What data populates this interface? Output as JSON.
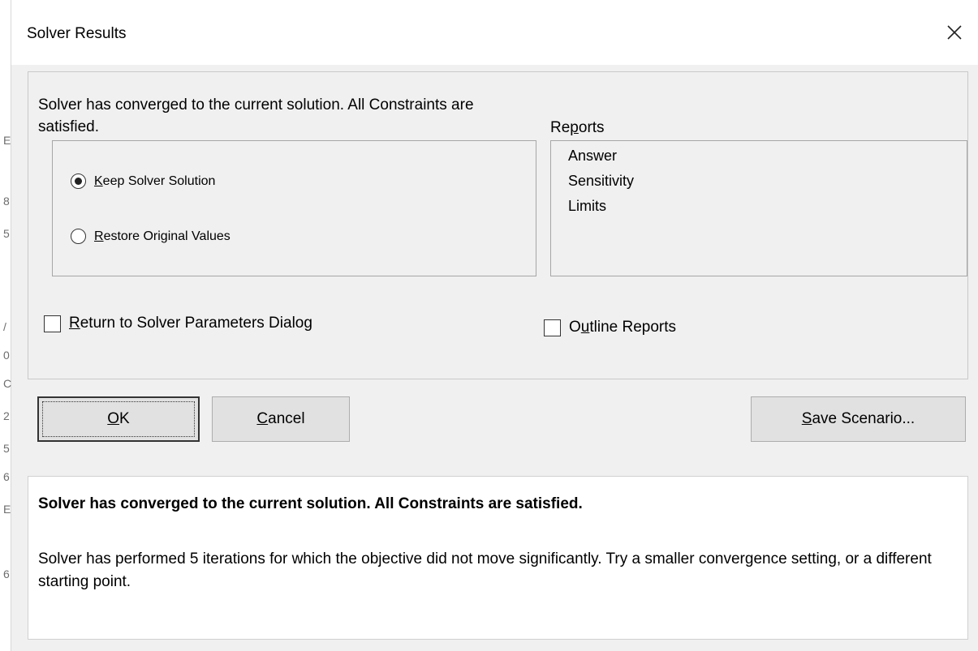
{
  "edge_glyphs": [
    "E",
    "8",
    "5",
    "/",
    "0",
    "C",
    "2",
    "5",
    "6",
    "E",
    "6"
  ],
  "window": {
    "title": "Solver Results",
    "close_icon": "close-x-icon"
  },
  "status_message": "Solver has converged to the current solution.  All Constraints are satisfied.",
  "options": {
    "keep": {
      "pre": "",
      "key": "K",
      "post": "eep Solver Solution",
      "selected": true
    },
    "restore": {
      "pre": "",
      "key": "R",
      "post": "estore Original Values",
      "selected": false
    }
  },
  "reports": {
    "label": {
      "pre": "Re",
      "key": "p",
      "post": "orts"
    },
    "items": [
      "Answer",
      "Sensitivity",
      "Limits"
    ]
  },
  "checkboxes": {
    "return_dialog": {
      "pre": "",
      "key": "R",
      "post": "eturn to Solver Parameters Dialog",
      "checked": false
    },
    "outline_reports": {
      "pre": "O",
      "key": "u",
      "post": "tline Reports",
      "checked": false
    }
  },
  "buttons": {
    "ok": {
      "pre": "",
      "key": "O",
      "post": "K"
    },
    "cancel": {
      "pre": "",
      "key": "C",
      "post": "ancel"
    },
    "save_scenario": {
      "pre": "",
      "key": "S",
      "post": "ave Scenario..."
    }
  },
  "message_panel": {
    "heading": "Solver has converged to the current solution.  All Constraints are satisfied.",
    "body": "Solver has performed 5 iterations for which the objective did not move significantly. Try a smaller convergence setting, or a different starting point."
  }
}
